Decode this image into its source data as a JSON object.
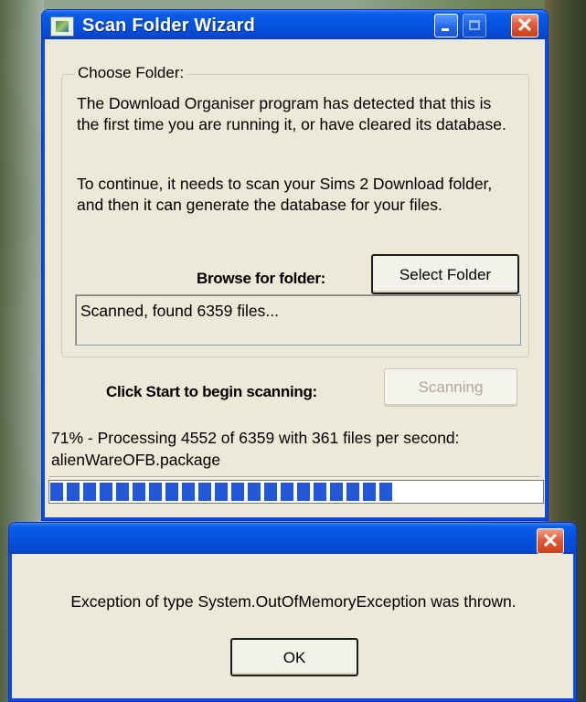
{
  "window": {
    "title": "Scan Folder Wizard",
    "minimize_icon": "minimize-icon",
    "maximize_icon": "maximize-icon",
    "close_glyph": "✕"
  },
  "choose_folder": {
    "group_label": "Choose Folder:",
    "paragraph1": "The Download Organiser program has detected that this is the first time you are running it, or have cleared its database.",
    "paragraph2": "To continue, it needs to scan your Sims 2 Download folder, and then it can generate the database for your files.",
    "browse_label": "Browse for folder:",
    "select_button": "Select Folder",
    "status_text": "Scanned, found 6359 files..."
  },
  "scan": {
    "start_label": "Click Start to begin scanning:",
    "scan_button": "Scanning"
  },
  "progress": {
    "line1": "71% - Processing 4552 of 6359 with 361 files per second:",
    "line2": "alienWareOFB.package",
    "percent": 71
  },
  "error_dialog": {
    "close_glyph": "✕",
    "message": "Exception of type System.OutOfMemoryException was thrown.",
    "ok_button": "OK"
  },
  "colors": {
    "titlebar_blue": "#0453e0",
    "progress_blue": "#2257d8",
    "close_red": "#e35b36",
    "face": "#ece9d8"
  }
}
